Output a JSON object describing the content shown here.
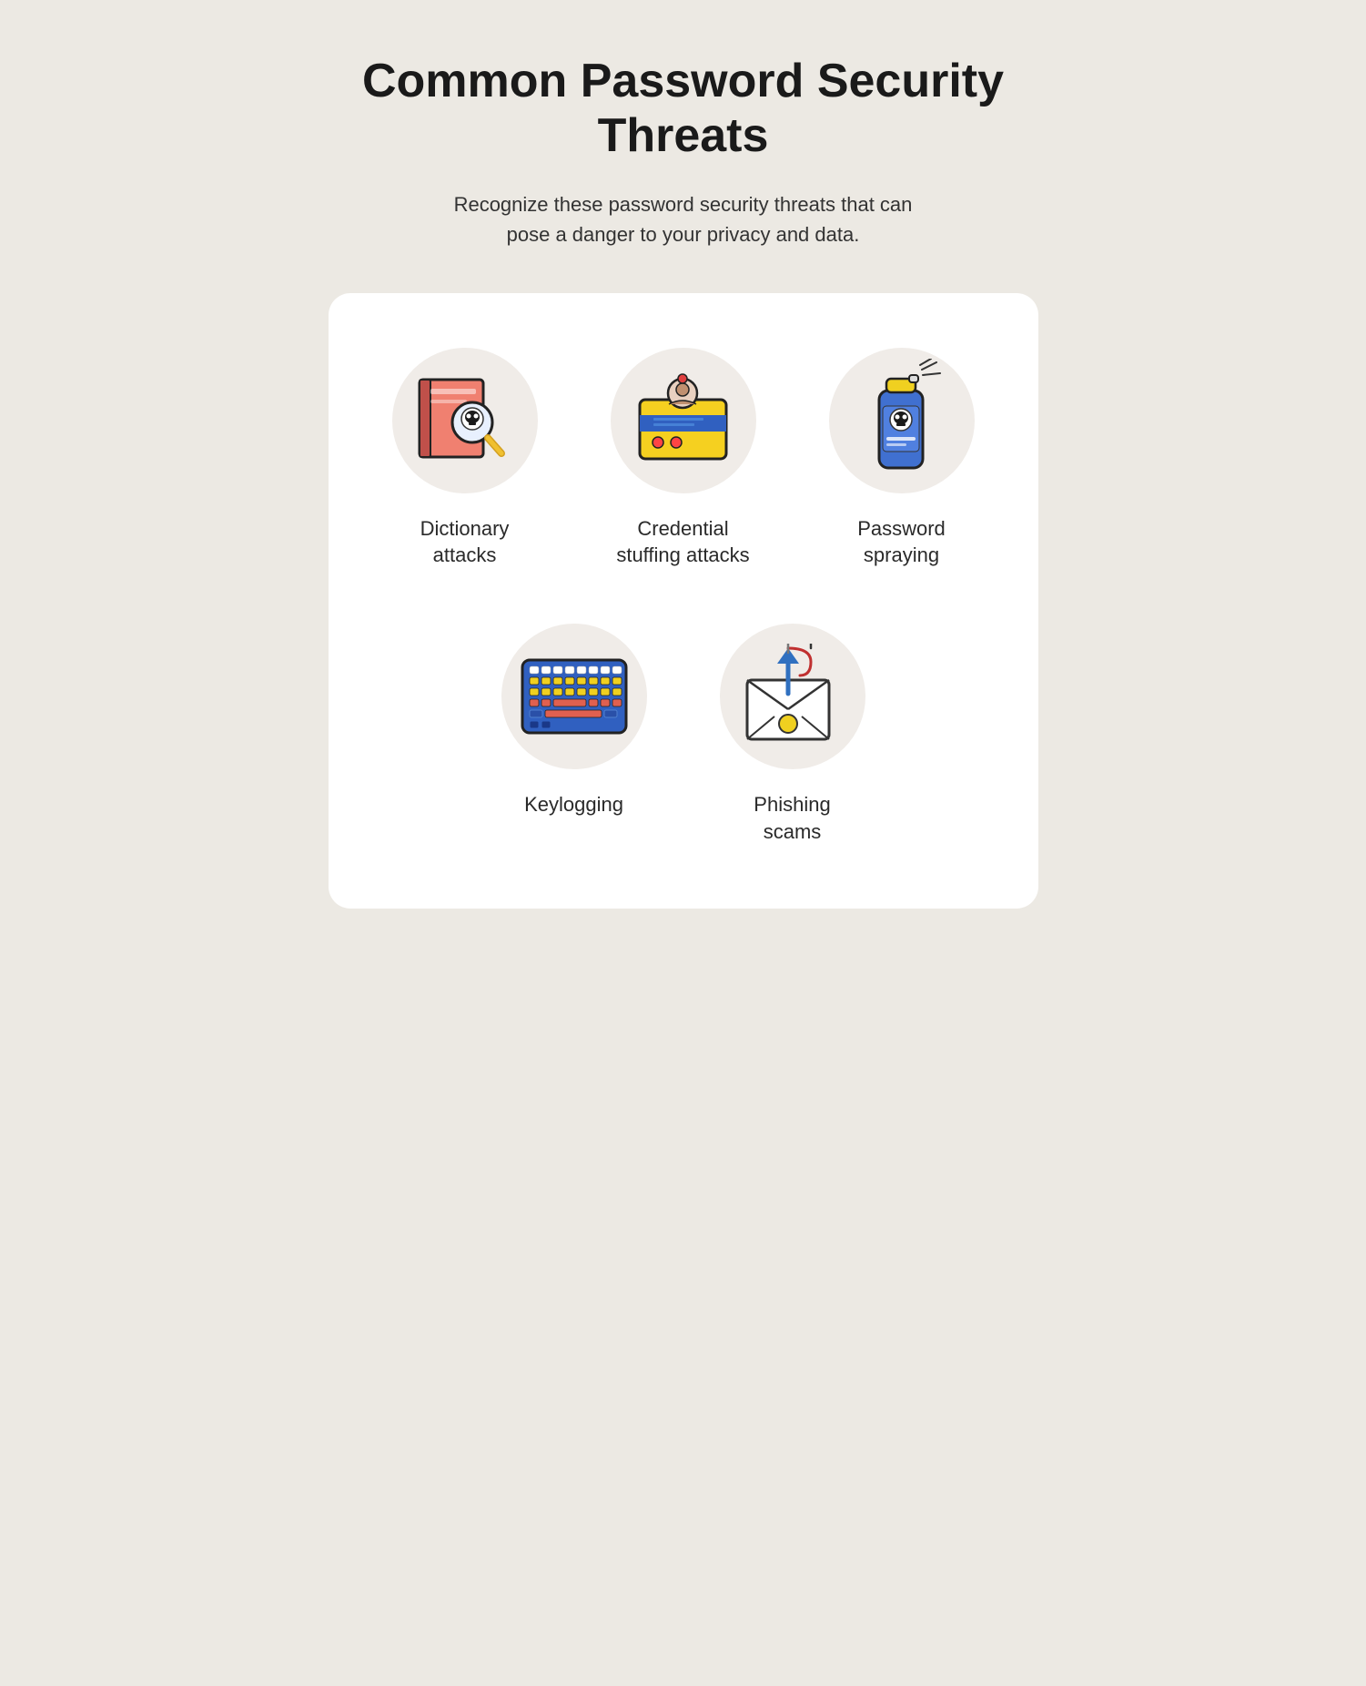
{
  "page": {
    "title": "Common Password Security Threats",
    "subtitle": "Recognize these password security threats that can pose a danger to your privacy and data.",
    "threats": [
      {
        "id": "dictionary-attacks",
        "label": "Dictionary\nattacks"
      },
      {
        "id": "credential-stuffing",
        "label": "Credential\nstuffing attacks"
      },
      {
        "id": "password-spraying",
        "label": "Password\nspraying"
      },
      {
        "id": "keylogging",
        "label": "Keylogging"
      },
      {
        "id": "phishing-scams",
        "label": "Phishing\nscams"
      }
    ]
  }
}
